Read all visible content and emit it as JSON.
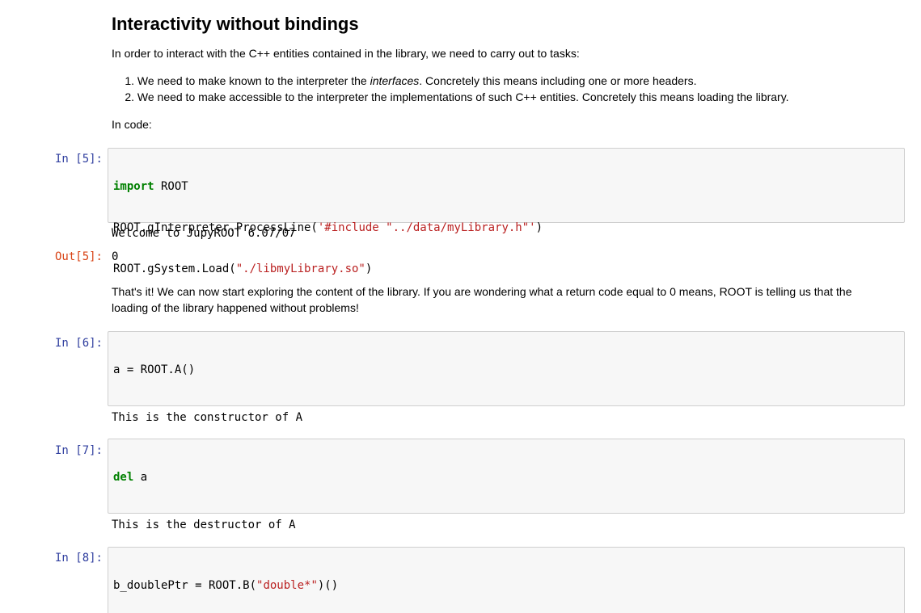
{
  "markdown_intro": {
    "heading": "Interactivity without bindings",
    "intro": "In order to interact with the C++ entities contained in the library, we need to carry out to tasks:",
    "list": [
      {
        "number": "1.",
        "before": "We need to make known to the interpreter the ",
        "emphasis": "interfaces",
        "after": ". Concretely this means including one or more headers."
      },
      {
        "number": "2.",
        "before": "We need to make accessible to the interpreter the implementations of such C++ entities. Concretely this means loading the library.",
        "emphasis": "",
        "after": ""
      }
    ],
    "in_code": "In code:"
  },
  "cells": [
    {
      "prompt": "In [5]:",
      "code": [
        [
          {
            "t": "kw",
            "v": "import"
          },
          {
            "t": "plain",
            "v": " ROOT"
          }
        ],
        [
          {
            "t": "plain",
            "v": "ROOT.gInterpreter.ProcessLine("
          },
          {
            "t": "str",
            "v": "'#include \"../data/myLibrary.h\"'"
          },
          {
            "t": "plain",
            "v": ")"
          }
        ],
        [
          {
            "t": "plain",
            "v": "ROOT.gSystem.Load("
          },
          {
            "t": "str",
            "v": "\"./libmyLibrary.so\""
          },
          {
            "t": "plain",
            "v": ")"
          }
        ]
      ],
      "stdout": "Welcome to JupyROOT 6.07/07",
      "out_prompt": "Out[5]:",
      "out_value": "0"
    },
    {
      "prompt": "In [6]:",
      "code": [
        [
          {
            "t": "plain",
            "v": "a = ROOT.A()"
          }
        ]
      ],
      "stdout": "This is the constructor of A"
    },
    {
      "prompt": "In [7]:",
      "code": [
        [
          {
            "t": "kw",
            "v": "del"
          },
          {
            "t": "plain",
            "v": " a"
          }
        ]
      ],
      "stdout": "This is the destructor of A"
    },
    {
      "prompt": "In [8]:",
      "code": [
        [
          {
            "t": "plain",
            "v": "b_doublePtr = ROOT.B("
          },
          {
            "t": "str",
            "v": "\"double*\""
          },
          {
            "t": "plain",
            "v": ")()"
          }
        ]
      ]
    }
  ],
  "markdown_mid": {
    "text": "That's it! We can now start exploring the content of the library. If you are wondering what a return code equal to 0 means, ROOT is telling us that the loading of the library happened without problems!"
  },
  "colors": {
    "keyword": "#008000",
    "string": "#ba2121",
    "in_prompt": "#303f9f",
    "out_prompt": "#d84315",
    "code_background": "#f7f7f7",
    "code_border": "#cfcfcf"
  }
}
